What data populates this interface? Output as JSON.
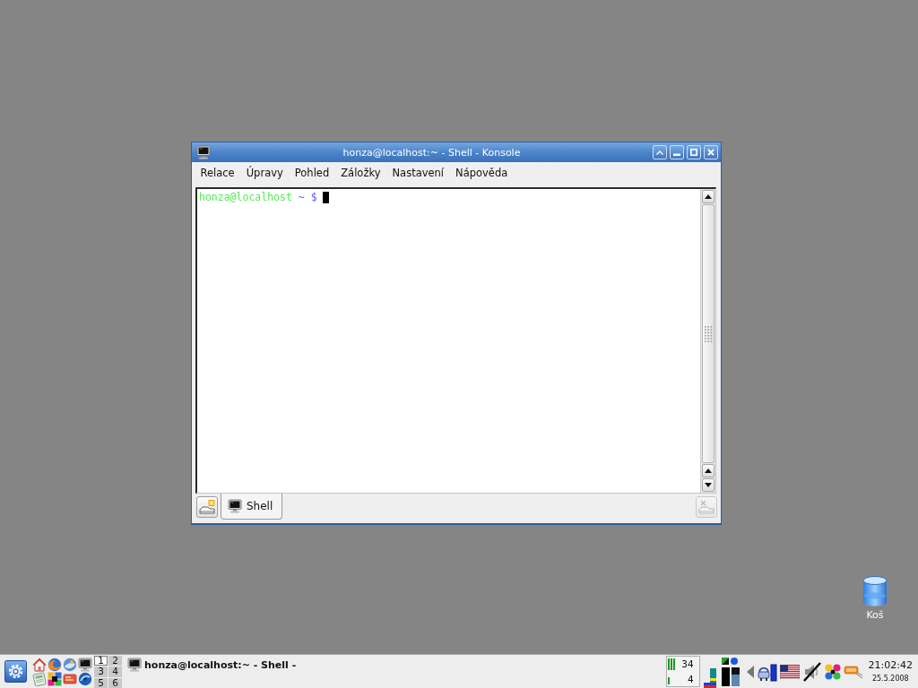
{
  "desktop_icons": [
    {
      "label": "Koš"
    }
  ],
  "window": {
    "title": "honza@localhost:~ - Shell - Konsole",
    "menu": [
      "Relace",
      "Úpravy",
      "Pohled",
      "Záložky",
      "Nastavení",
      "Nápověda"
    ],
    "terminal": {
      "lines": [
        {
          "segments": [
            {
              "text": "honza@localhost",
              "color": "#54ec54"
            },
            {
              "text": "~ $",
              "color": "#5a5af6"
            }
          ],
          "cursor": true
        }
      ]
    },
    "tabs": [
      {
        "label": "Shell",
        "selected": true
      }
    ],
    "close_tab_button": {
      "disabled": true
    }
  },
  "taskbar": {
    "pager": [
      {
        "label": "1",
        "selected": true
      },
      {
        "label": "2",
        "selected": false
      },
      {
        "label": "3",
        "selected": false
      },
      {
        "label": "4",
        "selected": false
      },
      {
        "label": "5",
        "selected": false
      },
      {
        "label": "6",
        "selected": false
      }
    ],
    "tasks": [
      {
        "label": "honza@localhost:~ - Shell -"
      }
    ],
    "system_monitor": {
      "readings": [
        "34",
        "4"
      ]
    },
    "clock": {
      "time": "21:02:42",
      "date": "25.5.2008"
    }
  }
}
